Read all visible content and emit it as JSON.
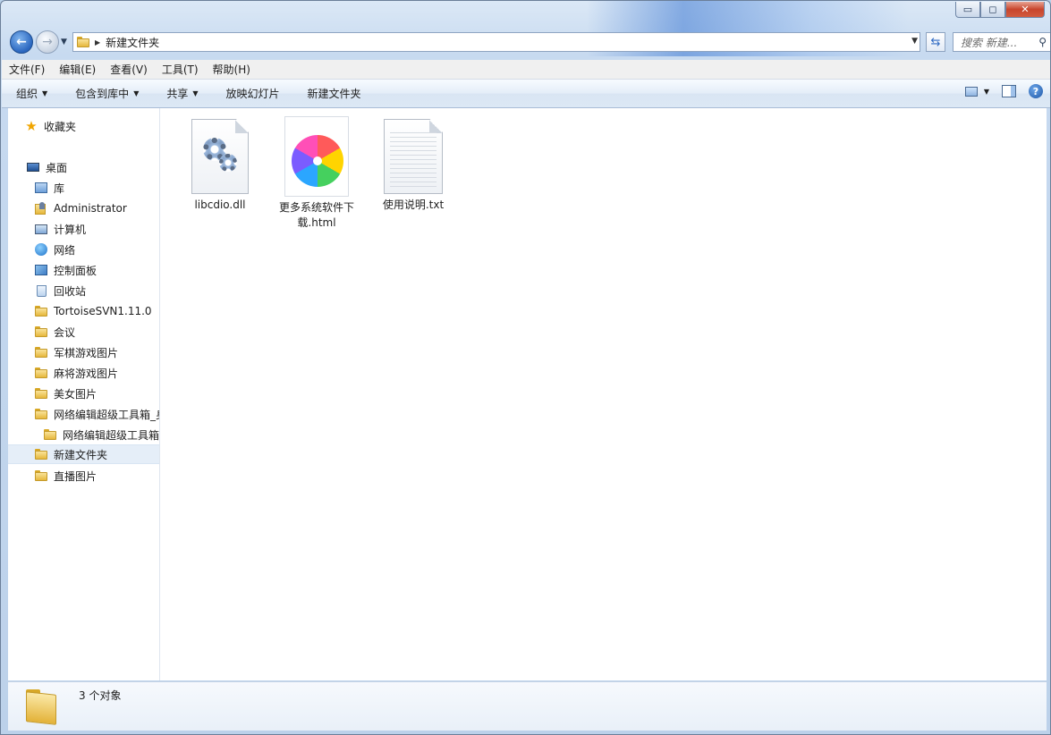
{
  "window": {
    "address_path": "新建文件夹",
    "search_placeholder": "搜索 新建...",
    "caption": {
      "minimize": "▭",
      "maximize": "◻",
      "close": "✕"
    }
  },
  "menu": [
    "文件(F)",
    "编辑(E)",
    "查看(V)",
    "工具(T)",
    "帮助(H)"
  ],
  "commands": {
    "organize": "组织",
    "include_library": "包含到库中",
    "share": "共享",
    "slideshow": "放映幻灯片",
    "new_folder": "新建文件夹"
  },
  "nav_pane": {
    "favorites": "收藏夹",
    "desktop": "桌面",
    "items": [
      {
        "label": "库",
        "icon": "library-icon"
      },
      {
        "label": "Administrator",
        "icon": "user-folder-icon"
      },
      {
        "label": "计算机",
        "icon": "computer-icon"
      },
      {
        "label": "网络",
        "icon": "network-icon"
      },
      {
        "label": "控制面板",
        "icon": "control-panel-icon"
      },
      {
        "label": "回收站",
        "icon": "recycle-bin-icon"
      },
      {
        "label": "TortoiseSVN1.11.0",
        "icon": "folder-icon"
      },
      {
        "label": "会议",
        "icon": "folder-icon"
      },
      {
        "label": "军棋游戏图片",
        "icon": "folder-icon"
      },
      {
        "label": "麻将游戏图片",
        "icon": "folder-icon"
      },
      {
        "label": "美女图片",
        "icon": "folder-icon"
      },
      {
        "label": "网络编辑超级工具箱_身",
        "icon": "folder-icon"
      },
      {
        "label": "网络编辑超级工具箱",
        "icon": "folder-icon"
      },
      {
        "label": "新建文件夹",
        "icon": "folder-icon",
        "selected": true
      },
      {
        "label": "直播图片",
        "icon": "folder-icon"
      }
    ]
  },
  "files": [
    {
      "name": "libcdio.dll",
      "icon": "dll-gears-icon"
    },
    {
      "name": "更多系统软件下载.html",
      "icon": "browser-pinwheel-icon"
    },
    {
      "name": "使用说明.txt",
      "icon": "text-document-icon"
    }
  ],
  "status": {
    "count_text": "3 个对象"
  }
}
